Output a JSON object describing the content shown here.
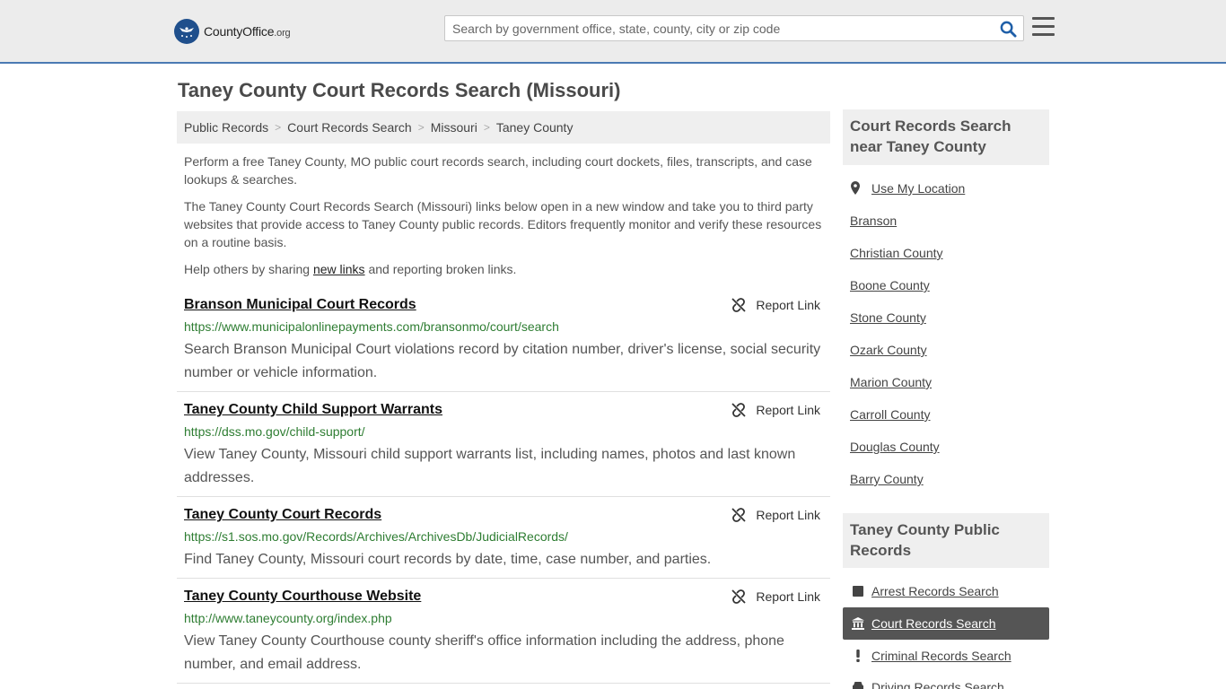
{
  "header": {
    "logo_county": "County",
    "logo_office": "Office",
    "logo_org": ".org",
    "search_placeholder": "Search by government office, state, county, city or zip code"
  },
  "page": {
    "title": "Taney County Court Records Search (Missouri)"
  },
  "breadcrumb": [
    "Public Records",
    "Court Records Search",
    "Missouri",
    "Taney County"
  ],
  "intro": {
    "p1": "Perform a free Taney County, MO public court records search, including court dockets, files, transcripts, and case lookups & searches.",
    "p2": "The Taney County Court Records Search (Missouri) links below open in a new window and take you to third party websites that provide access to Taney County public records. Editors frequently monitor and verify these resources on a routine basis.",
    "p3_before": "Help others by sharing ",
    "p3_link": "new links",
    "p3_after": " and reporting broken links."
  },
  "report_label": "Report Link",
  "results": [
    {
      "title": "Branson Municipal Court Records",
      "url": "https://www.municipalonlinepayments.com/bransonmo/court/search",
      "desc": "Search Branson Municipal Court violations record by citation number, driver's license, social security number or vehicle information."
    },
    {
      "title": "Taney County Child Support Warrants",
      "url": "https://dss.mo.gov/child-support/",
      "desc": "View Taney County, Missouri child support warrants list, including names, photos and last known addresses."
    },
    {
      "title": "Taney County Court Records",
      "url": "https://s1.sos.mo.gov/Records/Archives/ArchivesDb/JudicialRecords/",
      "desc": "Find Taney County, Missouri court records by date, time, case number, and parties."
    },
    {
      "title": "Taney County Courthouse Website",
      "url": "http://www.taneycounty.org/index.php",
      "desc": "View Taney County Courthouse county sheriff's office information including the address, phone number, and email address."
    }
  ],
  "sidebar": {
    "nearby_heading": "Court Records Search near Taney County",
    "use_location": "Use My Location",
    "nearby": [
      "Branson",
      "Christian County",
      "Boone County",
      "Stone County",
      "Ozark County",
      "Marion County",
      "Carroll County",
      "Douglas County",
      "Barry County"
    ],
    "public_heading": "Taney County Public Records",
    "public_items": [
      {
        "label": "Arrest Records Search",
        "icon": "square-icon",
        "active": false
      },
      {
        "label": "Court Records Search",
        "icon": "courthouse-icon",
        "active": true
      },
      {
        "label": "Criminal Records Search",
        "icon": "exclamation-icon",
        "active": false
      },
      {
        "label": "Driving Records Search",
        "icon": "car-icon",
        "active": false
      }
    ]
  },
  "colors": {
    "header_bg": "#ececec",
    "header_border": "#4b7ab3",
    "url_green": "#2e7d32",
    "active_item_bg": "#555555"
  }
}
